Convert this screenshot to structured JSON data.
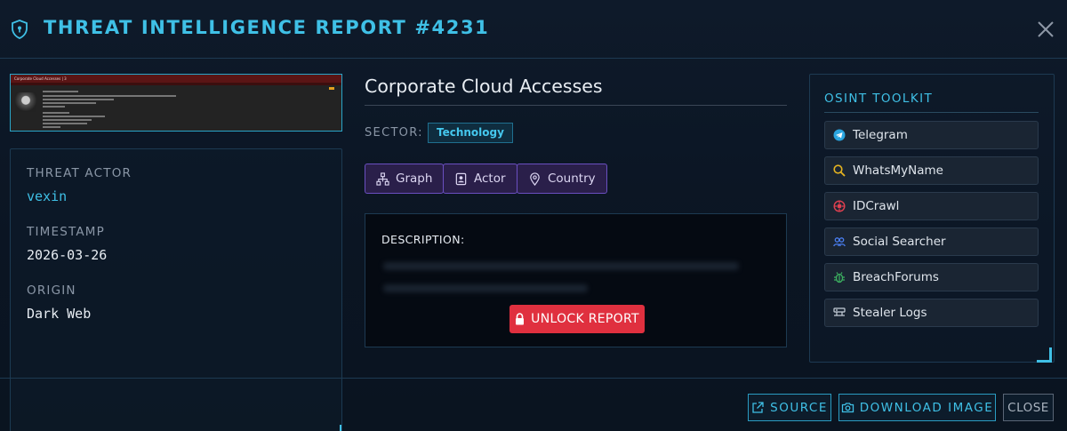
{
  "header": {
    "title": "THREAT INTELLIGENCE REPORT #4231",
    "icon": "shield-icon",
    "close_icon": "close-icon"
  },
  "thumbnail": {
    "title": "Corporate Cloud Accesses | 3"
  },
  "meta": {
    "actor_label": "THREAT ACTOR",
    "actor_value": "vexin",
    "timestamp_label": "TIMESTAMP",
    "timestamp_value": "2026-03-26",
    "origin_label": "ORIGIN",
    "origin_value": "Dark Web"
  },
  "report": {
    "title": "Corporate Cloud Accesses",
    "sector_label": "SECTOR:",
    "sector_value": "Technology",
    "pivots": [
      {
        "label": "Graph",
        "icon": "graph-icon"
      },
      {
        "label": "Actor",
        "icon": "id-card-icon"
      },
      {
        "label": "Country",
        "icon": "location-pin-icon"
      }
    ],
    "description_label": "DESCRIPTION:",
    "unlock_label": "UNLOCK REPORT"
  },
  "osint": {
    "title": "OSINT TOOLKIT",
    "tools": [
      {
        "label": "Telegram",
        "icon": "telegram-icon",
        "color": "#2aa5e0"
      },
      {
        "label": "WhatsMyName",
        "icon": "magnifier-icon",
        "color": "#e6b420"
      },
      {
        "label": "IDCrawl",
        "icon": "crawl-icon",
        "color": "#e04050"
      },
      {
        "label": "Social Searcher",
        "icon": "users-icon",
        "color": "#4a7ef0"
      },
      {
        "label": "BreachForums",
        "icon": "bug-icon",
        "color": "#3cb060"
      },
      {
        "label": "Stealer Logs",
        "icon": "server-icon",
        "color": "#c8d0da"
      }
    ]
  },
  "footer": {
    "source_label": "SOURCE",
    "download_label": "DOWNLOAD IMAGE",
    "close_label": "CLOSE"
  },
  "colors": {
    "accent": "#3fc0e6",
    "unlock": "#e0303f",
    "pivot": "#6a4fc0"
  }
}
